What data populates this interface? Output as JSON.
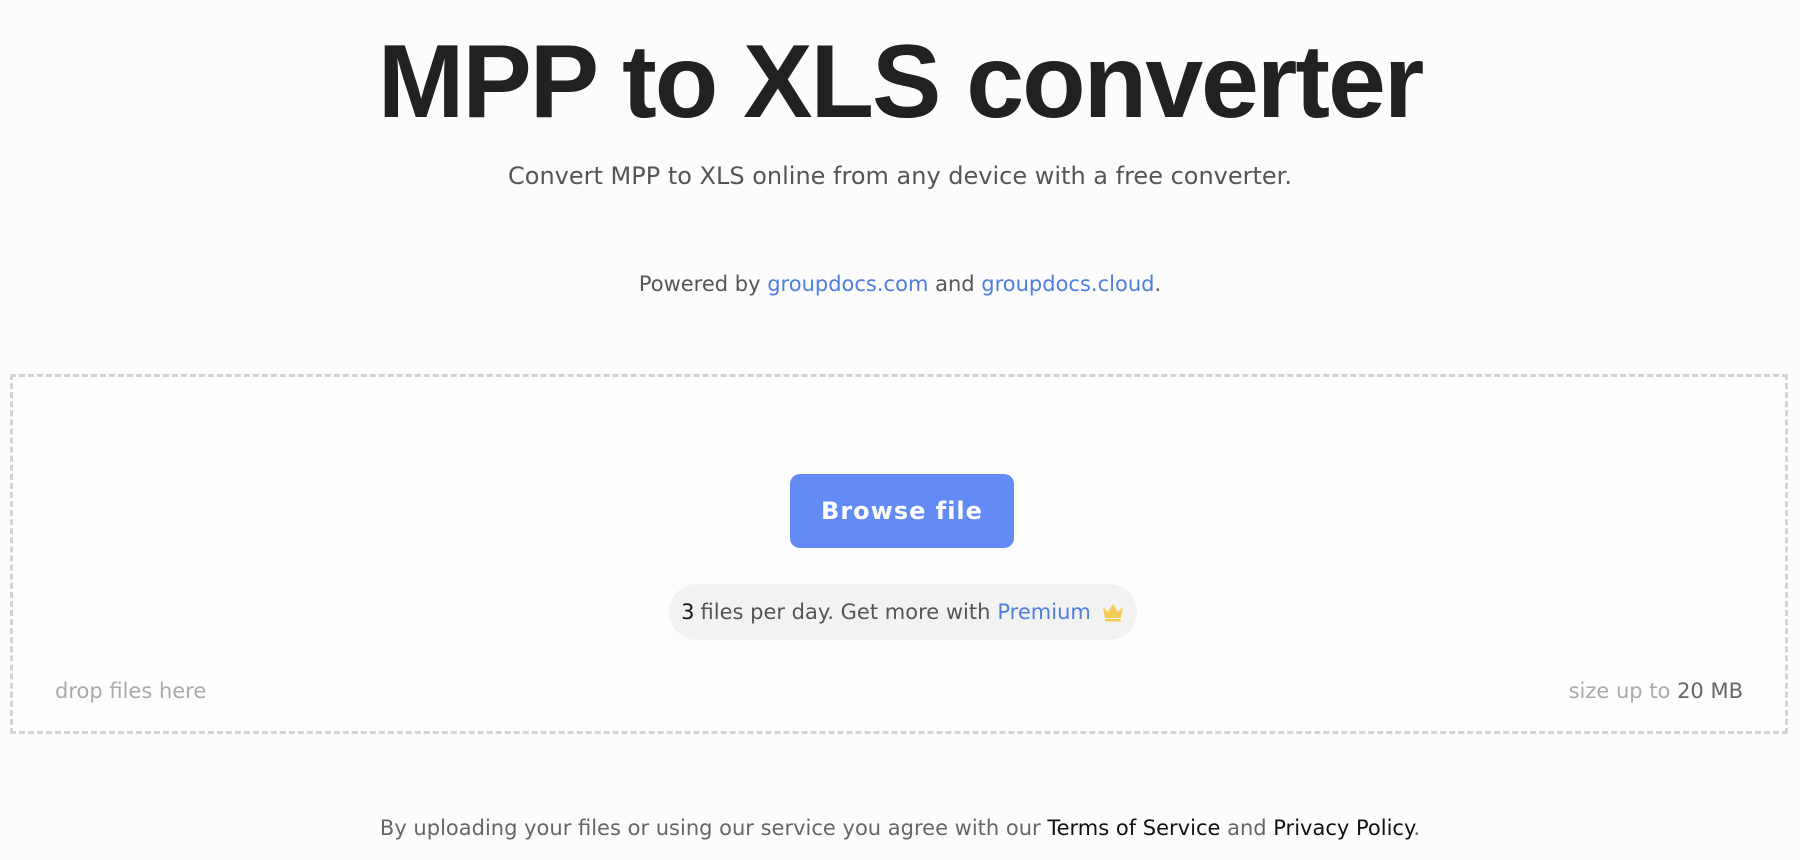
{
  "header": {
    "title": "MPP to XLS converter",
    "subtitle": "Convert MPP to XLS online from any device with a free converter."
  },
  "powered": {
    "prefix": "Powered by ",
    "link1": "groupdocs.com",
    "middle": " and ",
    "link2": "groupdocs.cloud",
    "suffix": "."
  },
  "dropzone": {
    "browse_label": "Browse file",
    "limit_count": "3",
    "limit_text": "files per day. Get more with",
    "premium_label": "Premium",
    "premium_icon": "crown-icon",
    "drop_hint": "drop files here",
    "size_prefix": "size up to ",
    "size_value": "20 MB"
  },
  "footer": {
    "terms_prefix": "By uploading your files or using our service you agree with our ",
    "terms_label": "Terms of Service",
    "terms_middle": " and ",
    "privacy_label": "Privacy Policy",
    "terms_suffix": "."
  },
  "colors": {
    "accent": "#628bf6",
    "link": "#4f7de0",
    "crown": "#f5cd56",
    "background": "#fcfcfc"
  }
}
